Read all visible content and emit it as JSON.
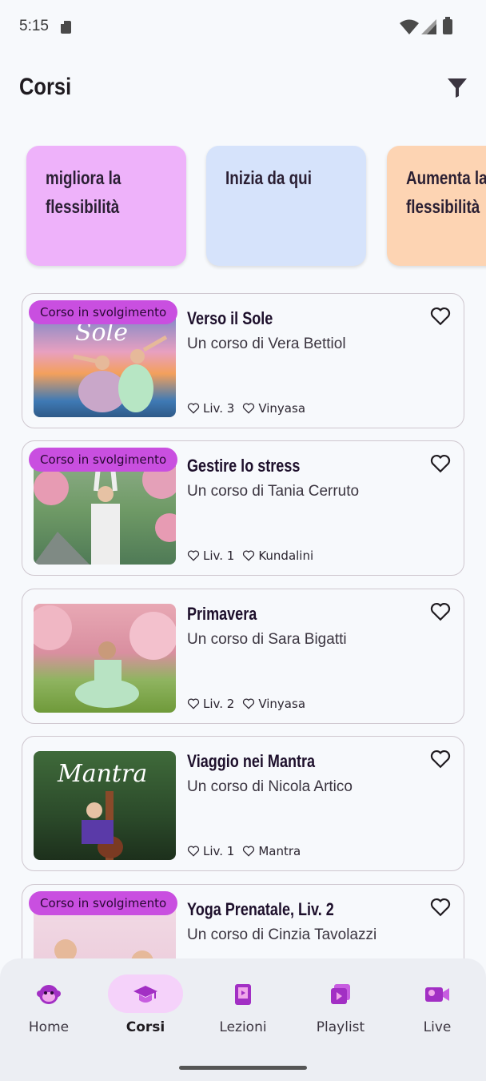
{
  "status": {
    "time": "5:15"
  },
  "header": {
    "title": "Corsi",
    "filter_icon": "filter-icon"
  },
  "categories": [
    {
      "label": "migliora la flessibilità",
      "color": "#eeb2fa"
    },
    {
      "label": "Inizia da qui",
      "color": "#d6e3fb"
    },
    {
      "label": "Aumenta la flessibilità",
      "color": "#fdd4b3"
    }
  ],
  "courses": [
    {
      "title": "Verso il Sole",
      "author": "Un corso di Vera Bettiol",
      "level": "Liv. 3",
      "style": "Vinyasa",
      "badge": "Corso in svolgimento",
      "thumb_caption": "Sole"
    },
    {
      "title": "Gestire lo stress",
      "author": "Un corso di Tania Cerruto",
      "level": "Liv. 1",
      "style": "Kundalini",
      "badge": "Corso in svolgimento"
    },
    {
      "title": "Primavera",
      "author": "Un corso di Sara Bigatti",
      "level": "Liv. 2",
      "style": "Vinyasa"
    },
    {
      "title": "Viaggio nei Mantra",
      "author": "Un corso di Nicola Artico",
      "level": "Liv. 1",
      "style": "Mantra",
      "thumb_caption": "Mantra"
    },
    {
      "title": "Yoga Prenatale, Liv. 2",
      "author": "Un corso di Cinzia Tavolazzi",
      "badge": "Corso in svolgimento"
    }
  ],
  "nav": {
    "items": [
      {
        "label": "Home",
        "icon": "monkey-icon"
      },
      {
        "label": "Corsi",
        "icon": "graduation-cap-icon",
        "active": true
      },
      {
        "label": "Lezioni",
        "icon": "lessons-icon"
      },
      {
        "label": "Playlist",
        "icon": "playlist-icon"
      },
      {
        "label": "Live",
        "icon": "live-video-icon"
      }
    ]
  },
  "colors": {
    "accent": "#c94fe0",
    "icon_purple": "#a22fc4",
    "badge_bg": "#c94fe0"
  }
}
